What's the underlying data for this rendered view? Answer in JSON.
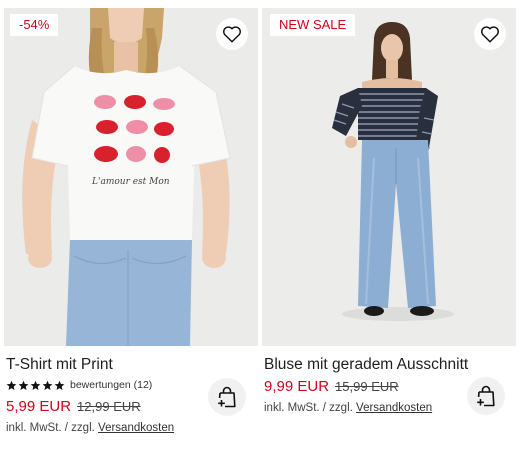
{
  "products": [
    {
      "badge": "-54%",
      "title": "T-Shirt mit Print",
      "rating": {
        "stars": 5,
        "text": "bewertungen (12)"
      },
      "price_now": "5,99 EUR",
      "price_old": "12,99 EUR",
      "tax_prefix": "inkl. MwSt. / zzgl.",
      "shipping_link": "Versandkosten",
      "print_script": "L'amour est Mon"
    },
    {
      "badge": "NEW SALE",
      "title": "Bluse mit geradem Ausschnitt",
      "price_now": "9,99 EUR",
      "price_old": "15,99 EUR",
      "tax_prefix": "inkl. MwSt. / zzgl.",
      "shipping_link": "Versandkosten"
    }
  ],
  "icons": {
    "wishlist": "heart-outline-icon",
    "add_to_cart": "shopping-bag-plus-icon",
    "rating": "star-icon"
  },
  "colors": {
    "sale_red": "#d0021b",
    "text": "#222222",
    "image_bg": "#ececeb",
    "cart_button_bg": "#f1f1f1"
  }
}
